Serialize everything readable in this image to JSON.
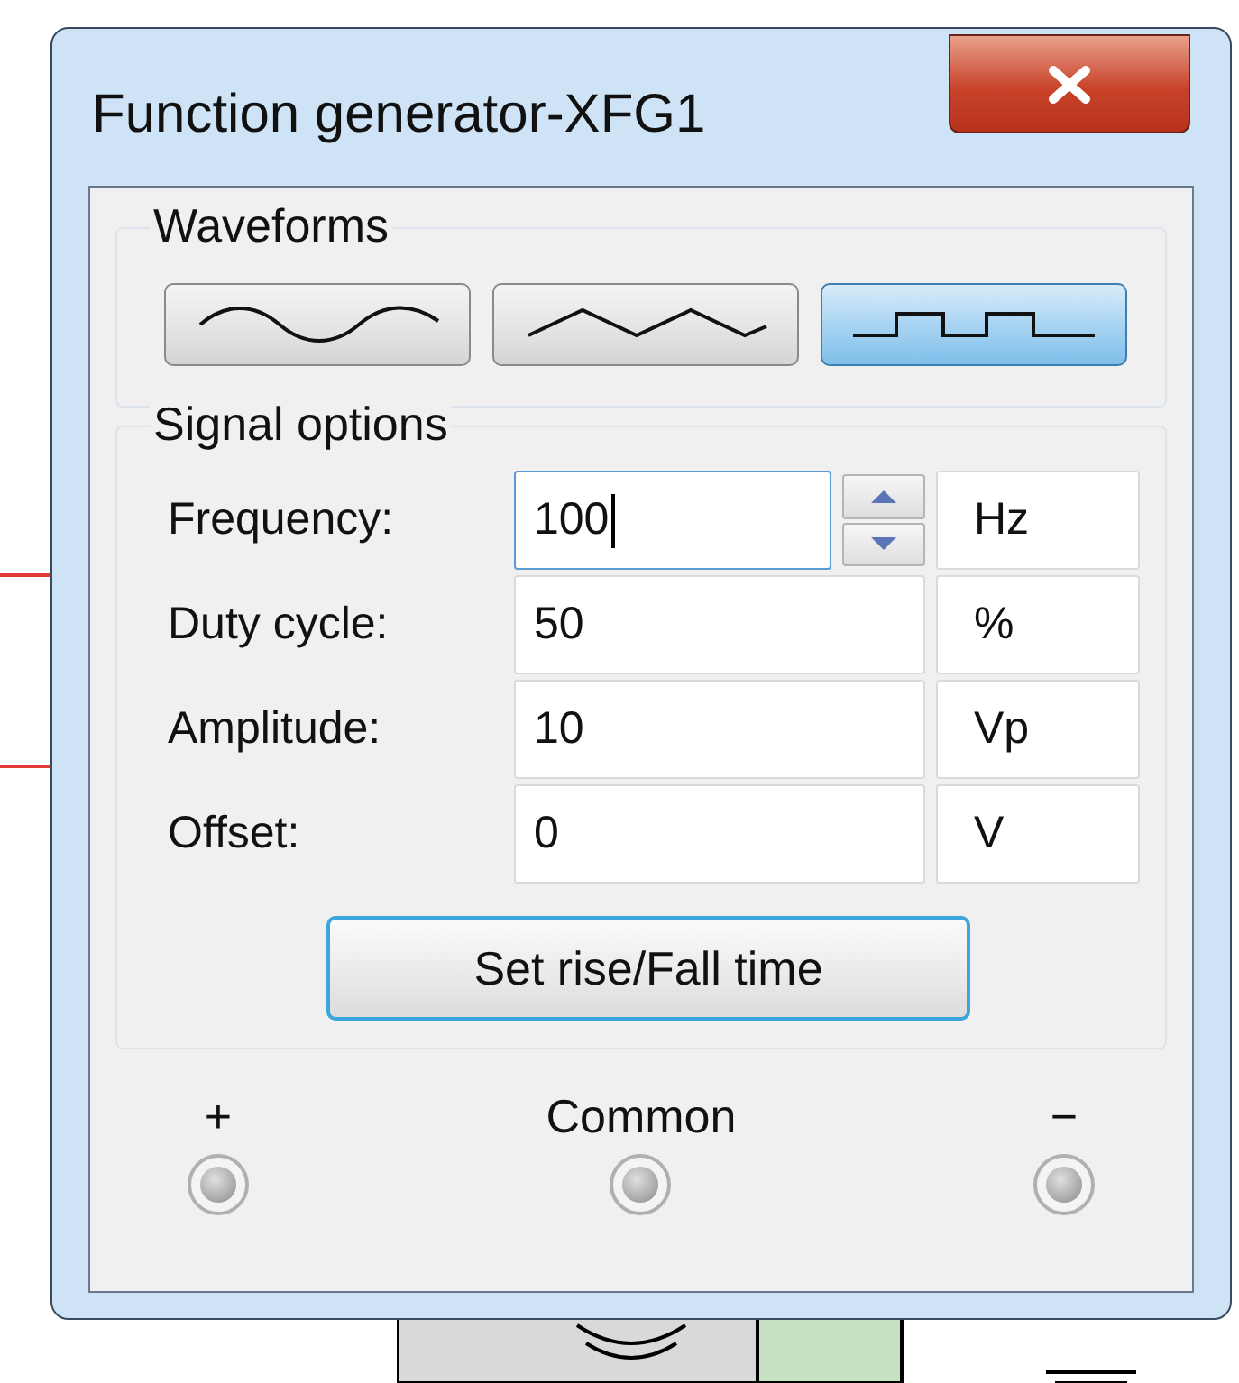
{
  "window": {
    "title": "Function generator-XFG1"
  },
  "waveforms": {
    "label": "Waveforms",
    "options": [
      {
        "kind": "sine",
        "selected": false
      },
      {
        "kind": "triangle",
        "selected": false
      },
      {
        "kind": "square",
        "selected": true
      }
    ]
  },
  "signal_options": {
    "label": "Signal options",
    "fields": [
      {
        "label": "Frequency:",
        "value": "100",
        "unit": "Hz",
        "kind": "spinner",
        "focused": true
      },
      {
        "label": "Duty cycle:",
        "value": "50",
        "unit": "%",
        "kind": "plain",
        "focused": false
      },
      {
        "label": "Amplitude:",
        "value": "10",
        "unit": "Vp",
        "kind": "plain",
        "focused": false
      },
      {
        "label": "Offset:",
        "value": "0",
        "unit": "V",
        "kind": "plain",
        "focused": false
      }
    ],
    "button": "Set rise/Fall time"
  },
  "terminals": [
    {
      "label": "+"
    },
    {
      "label": "Common"
    },
    {
      "label": "−"
    }
  ]
}
